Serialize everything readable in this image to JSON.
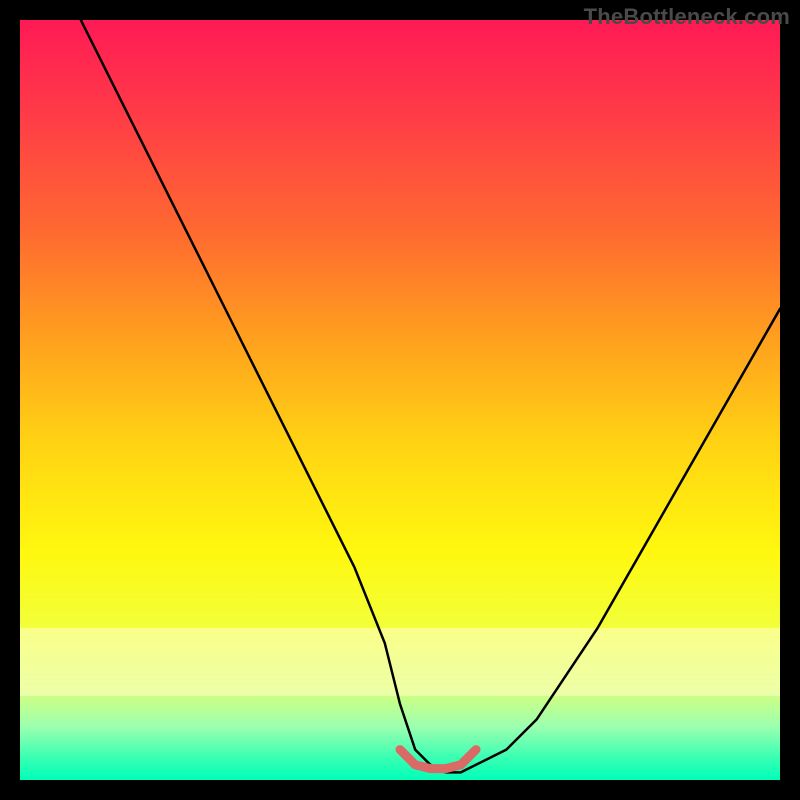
{
  "watermark": "TheBottleneck.com",
  "chart_data": {
    "type": "line",
    "title": "",
    "xlabel": "",
    "ylabel": "",
    "xlim": [
      0,
      100
    ],
    "ylim": [
      0,
      100
    ],
    "grid": false,
    "legend": false,
    "series": [
      {
        "name": "bottleneck-curve",
        "x": [
          8,
          12,
          16,
          20,
          24,
          28,
          32,
          36,
          40,
          44,
          48,
          50,
          52,
          54,
          56,
          58,
          60,
          64,
          68,
          72,
          76,
          80,
          84,
          88,
          92,
          96,
          100
        ],
        "values": [
          100,
          92,
          84,
          76,
          68,
          60,
          52,
          44,
          36,
          28,
          18,
          10,
          4,
          2,
          1,
          1,
          2,
          4,
          8,
          14,
          20,
          27,
          34,
          41,
          48,
          55,
          62
        ]
      }
    ],
    "highlight": {
      "name": "flat-minimum",
      "color": "#d96a65",
      "x": [
        50,
        52,
        54,
        56,
        58,
        60
      ],
      "values": [
        4,
        2,
        1.5,
        1.5,
        2,
        4
      ]
    },
    "band": {
      "y0": 78,
      "y1": 88
    },
    "gradient_stops": [
      {
        "offset": 0,
        "color": "#ff1a55"
      },
      {
        "offset": 12,
        "color": "#ff3a48"
      },
      {
        "offset": 28,
        "color": "#ff6a30"
      },
      {
        "offset": 42,
        "color": "#ffa01e"
      },
      {
        "offset": 56,
        "color": "#ffd413"
      },
      {
        "offset": 70,
        "color": "#fff80f"
      },
      {
        "offset": 80,
        "color": "#f2ff3a"
      },
      {
        "offset": 88,
        "color": "#d8ff7a"
      },
      {
        "offset": 93,
        "color": "#9cffb0"
      },
      {
        "offset": 97,
        "color": "#3affb2"
      },
      {
        "offset": 100,
        "color": "#00ffb8"
      }
    ]
  }
}
